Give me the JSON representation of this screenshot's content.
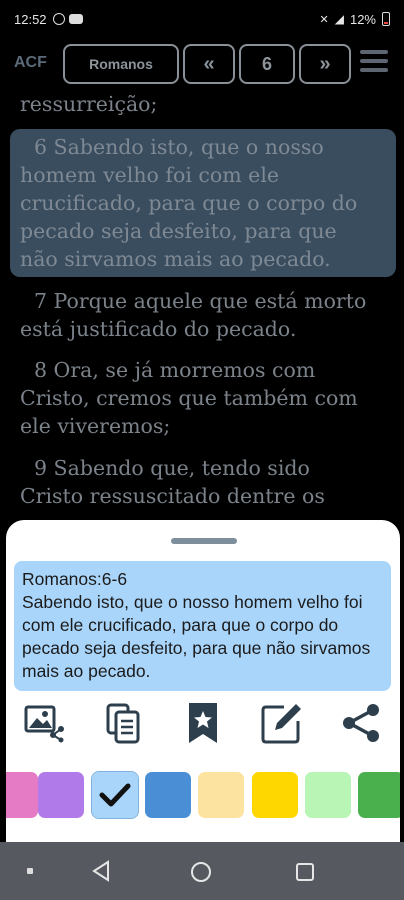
{
  "status_bar": {
    "time": "12:52",
    "battery": "12%"
  },
  "toolbar": {
    "version": "ACF",
    "book": "Romanos",
    "prev_label": "«",
    "chapter": "6",
    "next_label": "»"
  },
  "reader": {
    "top_fragment": "ressurreição;",
    "verses": [
      {
        "lines": [
          "6 Sabendo isto, que o nosso",
          "homem velho foi com ele",
          "crucificado, para que o corpo do",
          "pecado seja desfeito, para que",
          "não sirvamos mais ao pecado."
        ]
      },
      {
        "lines": [
          "7 Porque aquele que está morto",
          "está justificado do pecado."
        ]
      },
      {
        "lines": [
          "8 Ora, se já morremos com",
          "Cristo, cremos que também com",
          "ele viveremos;"
        ]
      },
      {
        "lines": [
          "9 Sabendo que, tendo sido",
          "Cristo ressuscitado dentre os"
        ]
      }
    ]
  },
  "sheet": {
    "reference": "Romanos:6-6",
    "quote": "Sabendo isto, que o nosso homem velho foi com ele crucificado, para que o corpo do pecado seja desfeito, para que não sirvamos mais ao pecado.",
    "actions": [
      "share-image-icon",
      "copy-icon",
      "bookmark-icon",
      "edit-note-icon",
      "share-icon"
    ],
    "colors": [
      "#e67bc5",
      "#b07ae8",
      "#a9d5fb",
      "#4a8fd6",
      "#fde3a0",
      "#ffd700",
      "#b9f5b4",
      "#49b04d"
    ],
    "selected_color": "#a9d5fb"
  }
}
